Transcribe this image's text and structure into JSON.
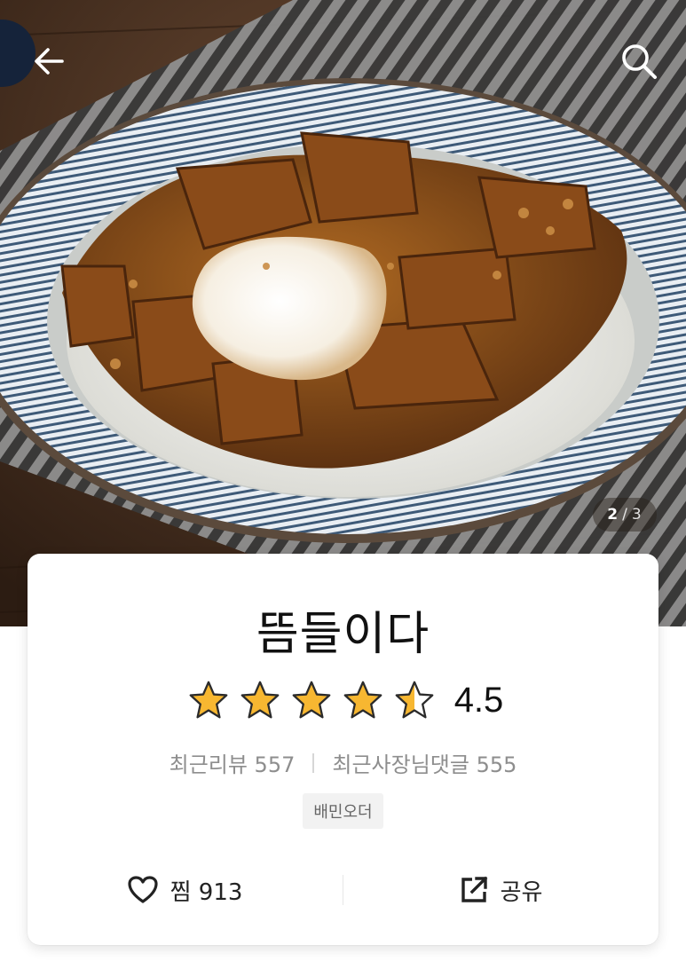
{
  "hero": {
    "image_alt": "",
    "page_indicator": {
      "current": "2",
      "separator": "/",
      "total": "3"
    }
  },
  "topbar": {
    "back_icon": "arrow-left-icon",
    "search_icon": "search-icon"
  },
  "store": {
    "name": "뜸들이다",
    "rating": 4.5,
    "rating_label": "4.5",
    "stars": 5,
    "recent_reviews_label": "최근리뷰 557",
    "recent_owner_replies_label": "최근사장님댓글 555",
    "badge": "배민오더"
  },
  "actions": {
    "like": {
      "icon": "heart-outline-icon",
      "label": "찜 913"
    },
    "share": {
      "icon": "share-icon",
      "label": "공유"
    }
  },
  "colors": {
    "star_fill": "#F7B731",
    "star_outline": "#2b2b2b",
    "text_primary": "#111111",
    "text_secondary": "#8e8e8e"
  }
}
